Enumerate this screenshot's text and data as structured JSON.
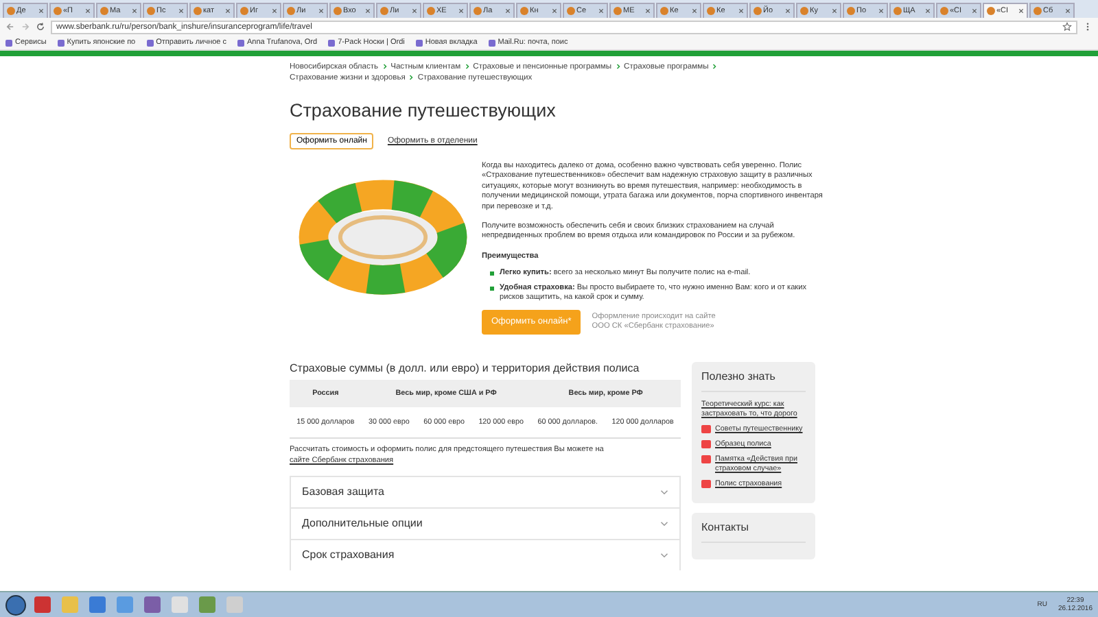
{
  "browser": {
    "tabs": [
      {
        "label": "Де",
        "selected": false
      },
      {
        "label": "«П",
        "selected": false
      },
      {
        "label": "Ма",
        "selected": false
      },
      {
        "label": "Пс",
        "selected": false
      },
      {
        "label": "кат",
        "selected": false
      },
      {
        "label": "Иг",
        "selected": false
      },
      {
        "label": "Ли",
        "selected": false
      },
      {
        "label": "Вхо",
        "selected": false
      },
      {
        "label": "Ли",
        "selected": false
      },
      {
        "label": "ХЕ",
        "selected": false
      },
      {
        "label": "Ла",
        "selected": false
      },
      {
        "label": "Кн",
        "selected": false
      },
      {
        "label": "Се",
        "selected": false
      },
      {
        "label": "МЕ",
        "selected": false
      },
      {
        "label": "Ке",
        "selected": false
      },
      {
        "label": "Ке",
        "selected": false
      },
      {
        "label": "Йо",
        "selected": false
      },
      {
        "label": "Ку",
        "selected": false
      },
      {
        "label": "По",
        "selected": false
      },
      {
        "label": "ЩА",
        "selected": false
      },
      {
        "label": "«СІ",
        "selected": false
      },
      {
        "label": "«СІ",
        "selected": true
      },
      {
        "label": "Сб",
        "selected": false
      }
    ],
    "url": "www.sberbank.ru/ru/person/bank_inshure/insuranceprogram/life/travel",
    "bookmarks": [
      "Сервисы",
      "Купить японские по",
      "Отправить личное с",
      "Anna Trufanova, Ord",
      "7-Pack Носки | Ordi",
      "Новая вкладка",
      "Mail.Ru: почта, поис"
    ]
  },
  "breadcrumb": [
    "Новосибирская область",
    "Частным клиентам",
    "Страховые и пенсионные программы",
    "Страховые программы",
    "Страхование жизни и здоровья",
    "Страхование путешествующих"
  ],
  "title": "Страхование путешествующих",
  "actions": [
    {
      "label": "Оформить онлайн",
      "kind": "button"
    },
    {
      "label": "Оформить в отделении",
      "kind": "link"
    }
  ],
  "intro": [
    "Когда вы находитесь далеко от дома, особенно важно чувствовать себя уверенно. Полис «Страхование путешественников» обеспечит вам надежную страховую защиту в различных ситуациях, которые могут возникнуть во время путешествия, например:  необходимость в получении медицинской помощи,  утрата багажа или документов, порча спортивного инвентаря при перевозке и т.д.",
    "Получите возможность обеспечить себя и своих близких страхованием на случай непредвиденных проблем во время отдыха или командировок по России и за рубежом."
  ],
  "advantages": {
    "title": "Преимущества",
    "items": [
      "**Легко купить:** всего за несколько минут Вы получите полис на e-mail.",
      "**Удобная страховка:**  Вы просто выбираете то, что нужно именно Вам: кого и от каких рисков защитить, на какой срок и сумму."
    ]
  },
  "cta": {
    "button": "Оформить онлайн*",
    "note": "Оформление происходит на сайте ООО СК «Сбербанк страхование»"
  },
  "sums": {
    "heading": "Страховые суммы (в долл. или евро) и территория действия полиса",
    "columns": [
      "Россия",
      "Весь мир, кроме США и РФ",
      "Весь мир, кроме РФ"
    ],
    "row": [
      "15 000 долларов",
      "30 000 евро",
      "60 000 евро",
      "120 000 евро",
      "60 000 долларов.",
      "120 000 долларов"
    ],
    "note": "Рассчитать стоимость и оформить полис для предстоящего путешествия Вы можете на ",
    "note_link": "сайте Сбербанк страхования"
  },
  "accordion": [
    {
      "label": "Базовая защита",
      "expanded": false
    },
    {
      "label": "Дополнительные опции",
      "expanded": false
    },
    {
      "label": "Срок страхования",
      "expanded": false
    }
  ],
  "sidebar": {
    "title": "Полезно знать",
    "links": [
      {
        "label": "Теоретический курс: как застраховать то, что дорого",
        "kind": "link"
      },
      {
        "label": "Советы путешественнику",
        "kind": "pdf"
      },
      {
        "label": "Образец полиса",
        "kind": "pdf"
      },
      {
        "label": "Памятка «Действия при страховом случае»",
        "kind": "pdf"
      },
      {
        "label": "Полис страхования",
        "kind": "pdf"
      }
    ]
  },
  "contacts": {
    "title": "Контакты"
  },
  "taskbar": {
    "language": "RU",
    "time": "22:39",
    "date": "26.12.2016"
  }
}
